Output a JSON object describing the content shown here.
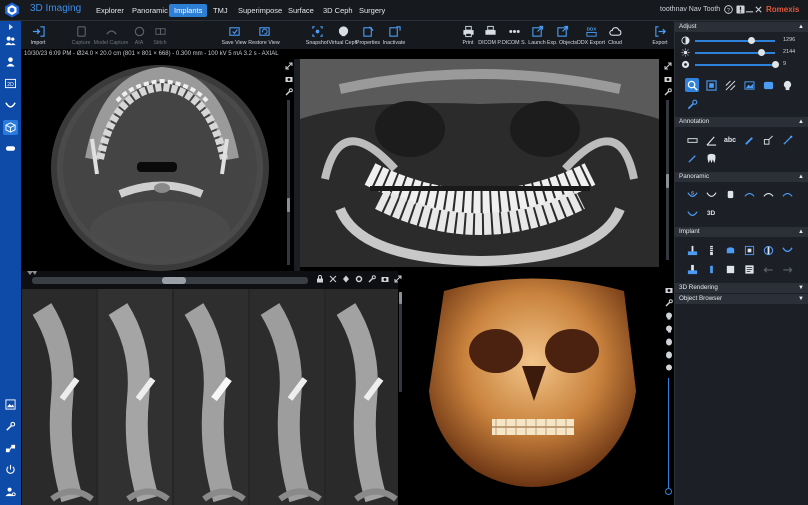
{
  "app": {
    "title": "3D Imaging",
    "brand": "Romexis",
    "patient_name": "toothnav Nav Tooth"
  },
  "tabs": [
    {
      "label": "Explorer",
      "active": false
    },
    {
      "label": "Panoramic",
      "active": false
    },
    {
      "label": "Implants",
      "active": true
    },
    {
      "label": "TMJ",
      "active": false
    },
    {
      "label": "Superimpose",
      "active": false
    },
    {
      "label": "Surface",
      "active": false
    },
    {
      "label": "3D Ceph",
      "active": false
    },
    {
      "label": "Surgery",
      "active": false
    }
  ],
  "window_controls": [
    "help-icon",
    "alert-icon",
    "minimize-icon",
    "maximize-icon",
    "close-icon"
  ],
  "toolbar": {
    "import": "Import",
    "capture": "Capture",
    "model_capture": "Model Capture",
    "aia": "AIA",
    "stitch": "Stitch",
    "save_view": "Save View",
    "restore_view": "Restore View",
    "snapshot": "Snapshot",
    "virtual_ceph": "Virtual Ceph",
    "properties": "Properties",
    "inactivate": "Inactivate",
    "print": "Print",
    "dicom_p": "DICOM P.",
    "dicom_s": "DICOM S.",
    "launch": "Launch",
    "exp_objects": "Exp. Objects",
    "ddx_export": "DDX Export",
    "cloud": "Cloud",
    "export": "Export"
  },
  "info_line": "10/30/23 6:09 PM - Ø24.0 × 20.0 cm (801 × 801 × 668) - 0.300 mm - 100 kV 5 mA 3.2 s - AXIAL",
  "right_panel": {
    "adjust": {
      "title": "Adjust",
      "sliders": [
        {
          "icon": "contrast-icon",
          "value": "1296",
          "level": 0.7
        },
        {
          "icon": "brightness-icon",
          "value": "2144",
          "level": 0.82
        },
        {
          "icon": "gamma-icon",
          "value": "9",
          "level": 0.97
        }
      ]
    },
    "annotation": {
      "title": "Annotation",
      "abc_label": "abc"
    },
    "panoramic": {
      "title": "Panoramic",
      "label_3d": "3D"
    },
    "implant": {
      "title": "Implant"
    },
    "rendering": {
      "title": "3D Rendering"
    },
    "object_browser": {
      "title": "Object Browser"
    }
  },
  "colors": {
    "accent": "#2d7fd6",
    "left_bar": "#0e4aa8",
    "brand": "#e2583a",
    "panel_bg": "#1c2026"
  }
}
